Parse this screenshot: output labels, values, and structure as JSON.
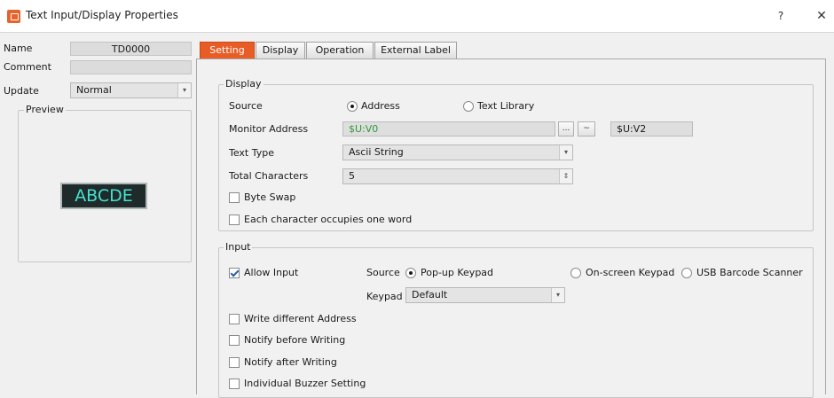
{
  "window": {
    "title": "Text Input/Display Properties",
    "help": "?",
    "close": "✕"
  },
  "left": {
    "name_label": "Name",
    "name_value": "TD0000",
    "comment_label": "Comment",
    "comment_value": "",
    "update_label": "Update",
    "update_value": "Normal",
    "preview_label": "Preview",
    "preview_text": "ABCDE"
  },
  "tabs": [
    "Setting",
    "Display",
    "Operation",
    "External Label"
  ],
  "display": {
    "title": "Display",
    "source_label": "Source",
    "source_opt1": "Address",
    "source_opt2": "Text Library",
    "monitor_label": "Monitor Address",
    "monitor_value": "$U:V0",
    "browse": "...",
    "tilde": "~",
    "monitor_end": "$U:V2",
    "texttype_label": "Text Type",
    "texttype_value": "Ascii String",
    "totalchars_label": "Total Characters",
    "totalchars_value": "5",
    "byteswap_label": "Byte Swap",
    "eachchar_label": "Each character occupies one word"
  },
  "input": {
    "title": "Input",
    "allow_label": "Allow Input",
    "source_label": "Source",
    "opt_popup": "Pop-up Keypad",
    "opt_onscreen": "On-screen Keypad",
    "opt_barcode": "USB Barcode Scanner",
    "keypad_label": "Keypad",
    "keypad_value": "Default",
    "write_diff": "Write different Address",
    "notify_before": "Notify before Writing",
    "notify_after": "Notify after Writing",
    "buzzer": "Individual Buzzer Setting"
  },
  "colors": {
    "accent": "#e85c26",
    "monitor_text": "#2e9a3a",
    "preview_text": "#46e0d0"
  }
}
